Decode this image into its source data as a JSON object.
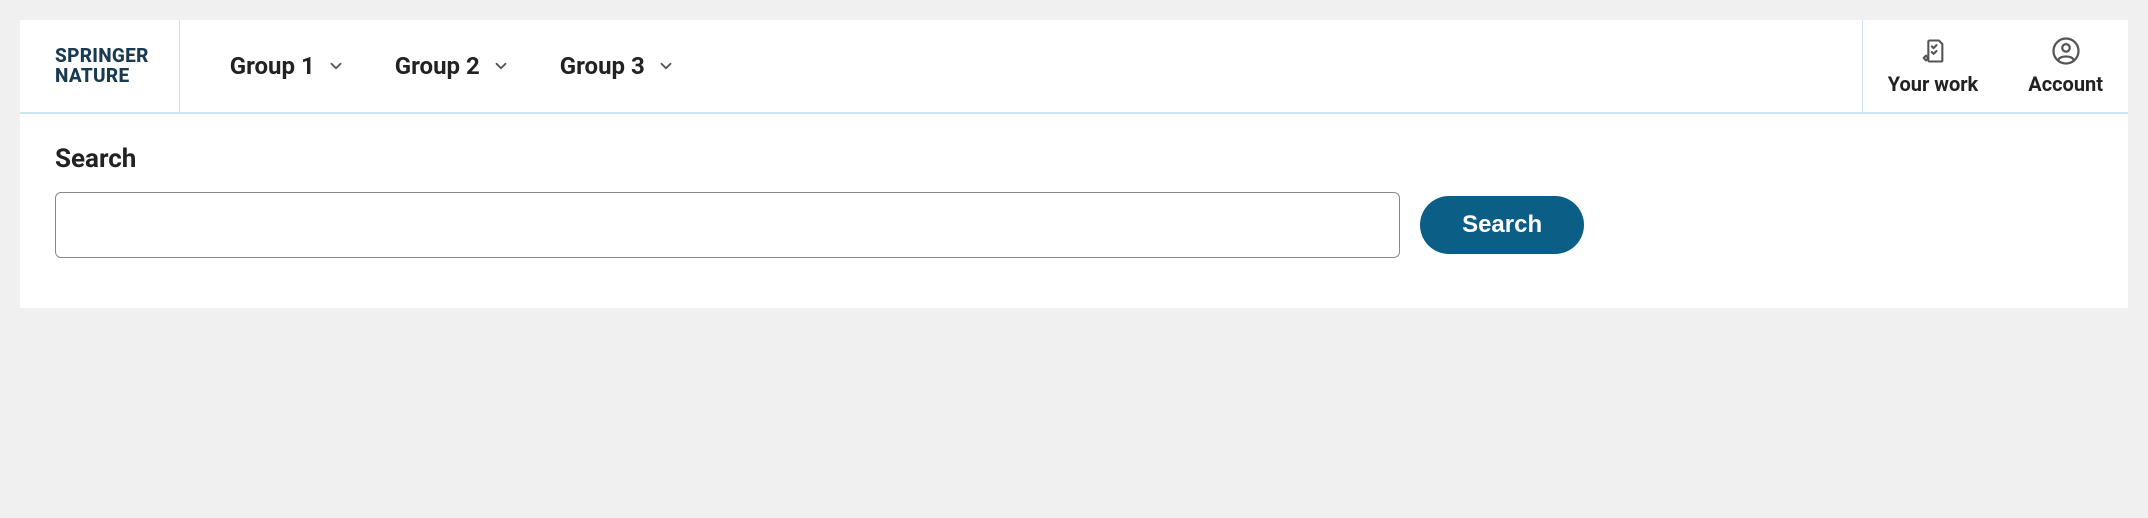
{
  "logo": {
    "line1": "SPRINGER",
    "line2": "NATURE"
  },
  "nav": {
    "items": [
      {
        "label": "Group 1"
      },
      {
        "label": "Group 2"
      },
      {
        "label": "Group 3"
      }
    ]
  },
  "rightNav": {
    "yourWork": "Your work",
    "account": "Account"
  },
  "search": {
    "heading": "Search",
    "value": "",
    "button": "Search"
  }
}
